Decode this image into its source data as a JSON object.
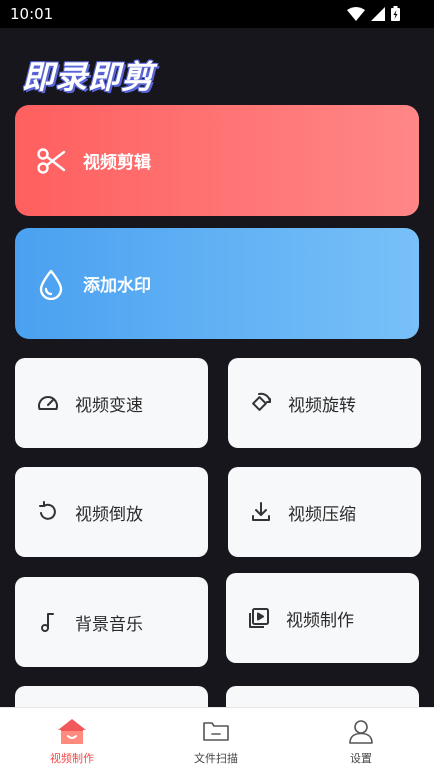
{
  "status": {
    "time": "10:01"
  },
  "app": {
    "title": "即录即剪"
  },
  "hero": [
    {
      "label": "视频剪辑",
      "icon": "scissors-icon",
      "color": "#ff6b6b"
    },
    {
      "label": "添加水印",
      "icon": "water-drop-icon",
      "color": "#5aaef3"
    }
  ],
  "tools": [
    {
      "label": "视频变速",
      "icon": "speedometer-icon"
    },
    {
      "label": "视频旋转",
      "icon": "rotate-icon"
    },
    {
      "label": "视频倒放",
      "icon": "reverse-icon"
    },
    {
      "label": "视频压缩",
      "icon": "download-icon"
    },
    {
      "label": "背景音乐",
      "icon": "music-note-icon"
    },
    {
      "label": "视频制作",
      "icon": "video-library-icon"
    }
  ],
  "nav": [
    {
      "label": "视频制作",
      "icon": "home-icon",
      "active": true,
      "accent": "#ef4b4b"
    },
    {
      "label": "文件扫描",
      "icon": "folder-icon",
      "active": false
    },
    {
      "label": "设置",
      "icon": "user-icon",
      "active": false
    }
  ]
}
